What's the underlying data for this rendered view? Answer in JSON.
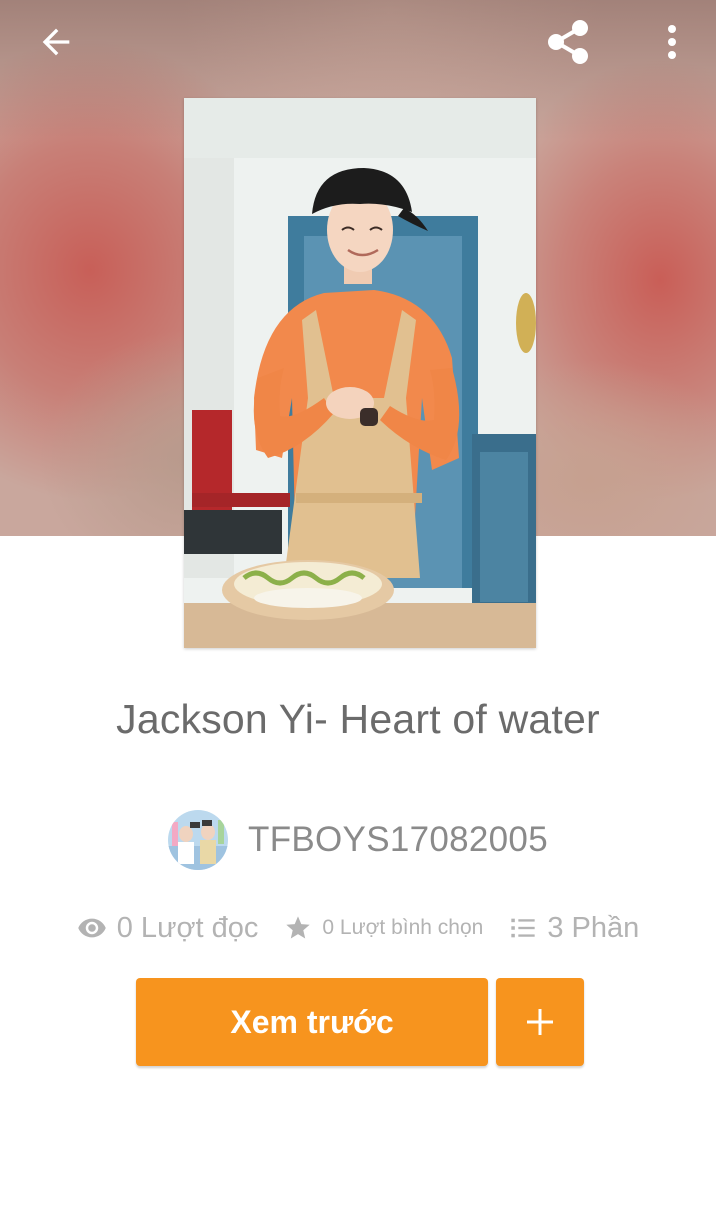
{
  "header": {
    "back_icon": "arrow-left-icon",
    "share_icon": "share-icon",
    "more_icon": "more-vertical-icon"
  },
  "story": {
    "title": "Jackson Yi- Heart of water",
    "author": "TFBOYS17082005",
    "stats": {
      "reads": "0 Lượt đọc",
      "votes": "0 Lượt bình chọn",
      "parts": "3 Phần"
    }
  },
  "actions": {
    "preview_label": "Xem trước",
    "add_icon": "plus-icon"
  },
  "colors": {
    "accent": "#f7941e",
    "title_text": "#6b6b6b",
    "author_text": "#8a8a8a",
    "stat_text": "#b3b3b3",
    "background": "#ffffff"
  }
}
